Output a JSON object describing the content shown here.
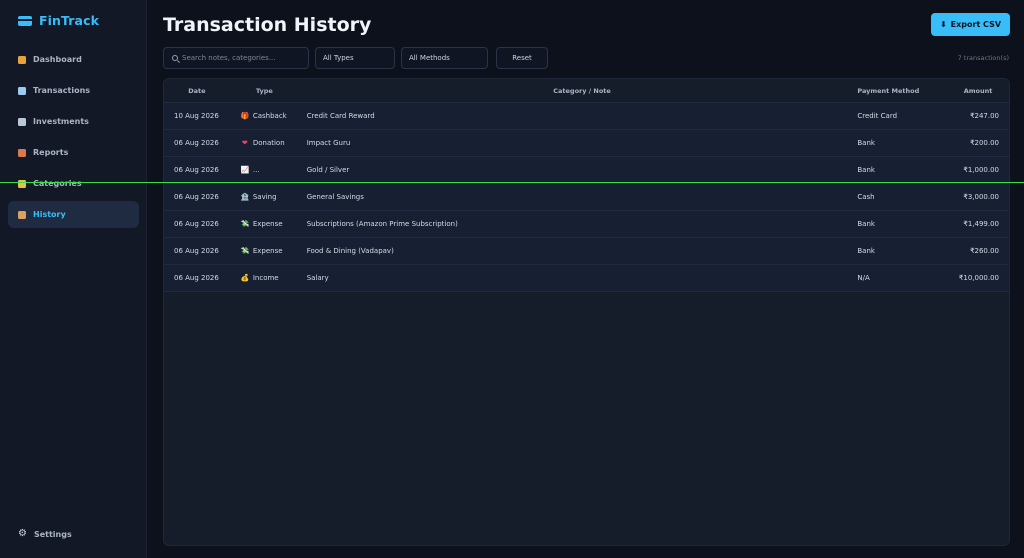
{
  "brand": {
    "name": "FinTrack"
  },
  "sidebar": {
    "items": [
      {
        "label": "Dashboard",
        "icon": "house-icon",
        "color": "#e8a23a",
        "active": false
      },
      {
        "label": "Transactions",
        "icon": "table-icon",
        "color": "#9cc9f0",
        "active": false
      },
      {
        "label": "Investments",
        "icon": "trend-chart-icon",
        "color": "#b9c7d9",
        "active": false
      },
      {
        "label": "Reports",
        "icon": "bar-chart-icon",
        "color": "#d97a4a",
        "active": false
      },
      {
        "label": "Categories",
        "icon": "tag-icon",
        "color": "#e6c14a",
        "active": false
      },
      {
        "label": "History",
        "icon": "scroll-icon",
        "color": "#d9a062",
        "active": true
      }
    ],
    "settings_label": "Settings"
  },
  "header": {
    "title": "Transaction History",
    "export_label": "Export CSV"
  },
  "filters": {
    "search_placeholder": "Search notes, categories...",
    "type_select": "All Types",
    "method_select": "All Methods",
    "reset_label": "Reset",
    "count": "7 transaction(s)"
  },
  "table": {
    "columns": [
      "Date",
      "Type",
      "Category / Note",
      "Payment Method",
      "Amount"
    ],
    "rows": [
      {
        "date": "10 Aug 2026",
        "type": "Cashback",
        "type_icon": "🎁",
        "category": "Credit Card Reward",
        "method": "Credit Card",
        "amount": "₹247.00"
      },
      {
        "date": "06 Aug 2026",
        "type": "Donation",
        "type_icon": "❤",
        "category": "Impact Guru",
        "method": "Bank",
        "amount": "₹200.00"
      },
      {
        "date": "06 Aug 2026",
        "type": "...",
        "type_icon": "📈",
        "category": "Gold / Silver",
        "method": "Bank",
        "amount": "₹1,000.00"
      },
      {
        "date": "06 Aug 2026",
        "type": "Saving",
        "type_icon": "🏦",
        "category": "General Savings",
        "method": "Cash",
        "amount": "₹3,000.00"
      },
      {
        "date": "06 Aug 2026",
        "type": "Expense",
        "type_icon": "💸",
        "category": "Subscriptions (Amazon Prime Subscription)",
        "method": "Bank",
        "amount": "₹1,499.00"
      },
      {
        "date": "06 Aug 2026",
        "type": "Expense",
        "type_icon": "💸",
        "category": "Food & Dining (Vadapav)",
        "method": "Bank",
        "amount": "₹260.00"
      },
      {
        "date": "06 Aug 2026",
        "type": "Income",
        "type_icon": "💰",
        "category": "Salary",
        "method": "N/A",
        "amount": "₹10,000.00"
      }
    ]
  },
  "colors": {
    "accent": "#38bdf8",
    "background": "#0c111b",
    "sidebar": "#121826",
    "guide_line": "#3ddc4a"
  }
}
